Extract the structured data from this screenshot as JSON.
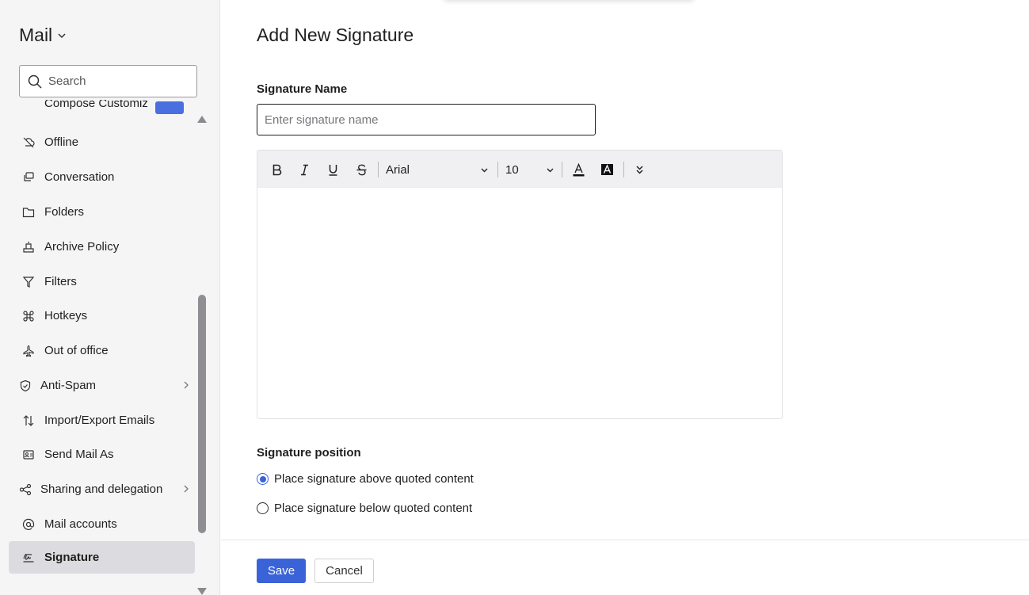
{
  "sidebar": {
    "app_title": "Mail",
    "search_placeholder": "Search",
    "partial_item": "Compose Customiz",
    "items": [
      {
        "label": "Offline",
        "icon": "offline-icon"
      },
      {
        "label": "Conversation",
        "icon": "conversation-icon"
      },
      {
        "label": "Folders",
        "icon": "folder-icon"
      },
      {
        "label": "Archive Policy",
        "icon": "archive-icon"
      },
      {
        "label": "Filters",
        "icon": "filter-icon"
      },
      {
        "label": "Hotkeys",
        "icon": "command-key-icon"
      },
      {
        "label": "Out of office",
        "icon": "plane-icon"
      },
      {
        "label": "Anti-Spam",
        "icon": "shield-check-icon"
      },
      {
        "label": "Import/Export Emails",
        "icon": "import-export-icon"
      },
      {
        "label": "Send Mail As",
        "icon": "send-as-icon"
      },
      {
        "label": "Sharing and delegation",
        "icon": "share-icon"
      },
      {
        "label": "Mail accounts",
        "icon": "at-icon"
      },
      {
        "label": "Signature",
        "icon": "signature-icon"
      }
    ]
  },
  "main": {
    "title": "Add New Signature",
    "name_label": "Signature Name",
    "name_placeholder": "Enter signature name",
    "name_value": "",
    "toolbar": {
      "font_family": "Arial",
      "font_size": "10"
    },
    "position_label": "Signature position",
    "position_options": [
      {
        "label": "Place signature above quoted content",
        "selected": true
      },
      {
        "label": "Place signature below quoted content",
        "selected": false
      }
    ],
    "save_label": "Save",
    "cancel_label": "Cancel"
  },
  "colors": {
    "accent": "#3b63d8",
    "sidebar_bg": "#f5f5f6",
    "active_item_bg": "#dcdce0"
  }
}
